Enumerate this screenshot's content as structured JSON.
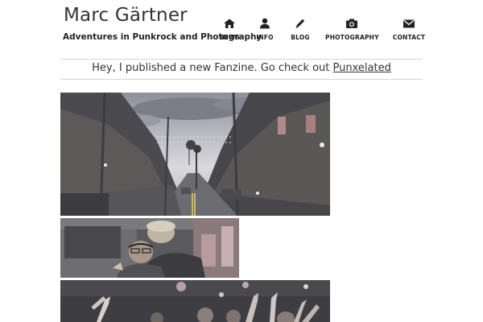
{
  "header": {
    "site_title": "Marc Gärtner",
    "tagline": "Adventures in Punkrock and Photography"
  },
  "nav": {
    "items": [
      {
        "label": "NEWS",
        "icon": "home-icon"
      },
      {
        "label": "INFO",
        "icon": "person-icon"
      },
      {
        "label": "BLOG",
        "icon": "pencil-icon"
      },
      {
        "label": "PHOTOGRAPHY",
        "icon": "camera-icon"
      },
      {
        "label": "CONTACT",
        "icon": "envelope-icon"
      }
    ]
  },
  "announcement": {
    "text": "Hey, I published a new Fanzine. Go check out",
    "link_text": "Punxelated"
  },
  "gallery": {
    "photos": [
      {
        "subject": "street-photo"
      },
      {
        "subject": "concert-hug-photo"
      },
      {
        "subject": "crowd-photo"
      }
    ]
  },
  "colors": {
    "accent_text": "#222222",
    "divider": "#d6d6d6"
  }
}
